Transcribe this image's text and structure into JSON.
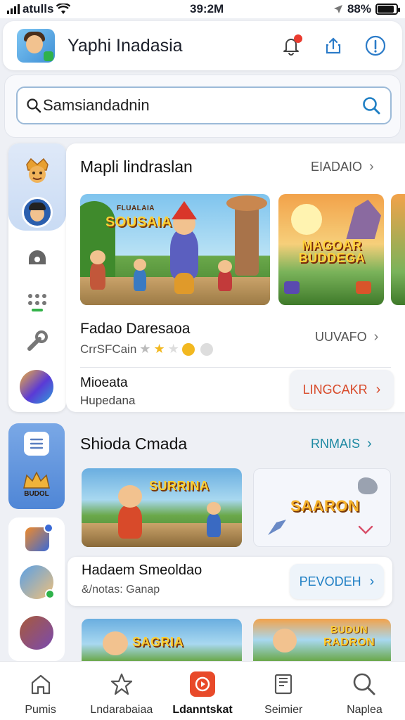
{
  "status_bar": {
    "carrier": "atulls",
    "time": "39:2M",
    "battery": "88%",
    "battery_level": 0.88
  },
  "header": {
    "title": "Yaphi Inadasia"
  },
  "search": {
    "value": "Samsiandadnin"
  },
  "section1": {
    "title": "Mapli lindraslan",
    "link": "EIADAIO",
    "banners": [
      {
        "caption": "SOUSAIA",
        "small": "FLUALAIA"
      },
      {
        "caption": "MAGOAR BUDDEGA"
      }
    ],
    "item": {
      "title": "Fadao Daresaoa",
      "sub": "CrrSFCain",
      "link": "UUVAFO"
    },
    "item2": {
      "title": "Mioeata",
      "sub": "Hupedana",
      "button": "LINGCAKR"
    }
  },
  "section2": {
    "title": "Shioda Cmada",
    "link": "RNMAIS",
    "banners": [
      {
        "caption": "SURRINA"
      },
      {
        "caption": "SAARON"
      }
    ]
  },
  "section3": {
    "title": "Hadaem Smeoldao",
    "sub": "&/notas: Ganap",
    "button": "PEVODEH"
  },
  "bottom_banners": [
    {
      "caption": "SAGRIA"
    },
    {
      "caption": "RADRON",
      "small": "BUDUN"
    }
  ],
  "rail2_caption": "BUDOL",
  "tabs": [
    {
      "label": "Pumis",
      "icon": "home-icon"
    },
    {
      "label": "Lndarabaiaa",
      "icon": "star-icon"
    },
    {
      "label": "Ldanntskat",
      "icon": "play-icon",
      "active": true
    },
    {
      "label": "Seimier",
      "icon": "book-icon"
    },
    {
      "label": "Naplea",
      "icon": "search-icon"
    }
  ],
  "colors": {
    "accent": "#e84a2a",
    "link_blue": "#2b7bc8",
    "teal": "#1f8aa3"
  }
}
